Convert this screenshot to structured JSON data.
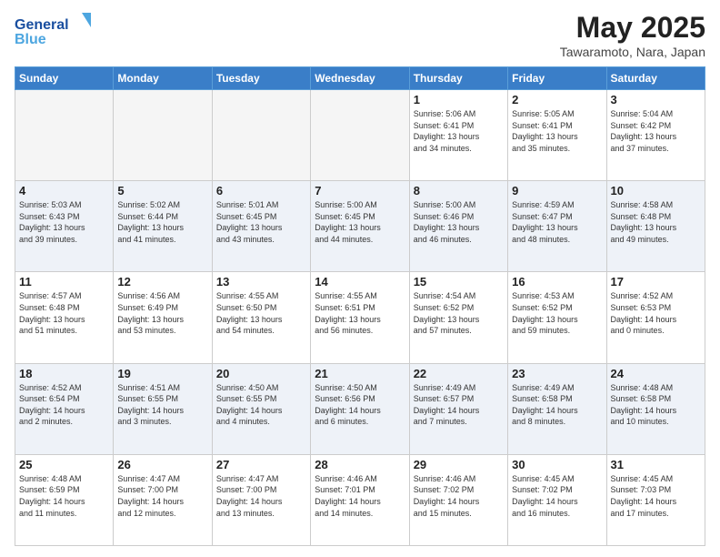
{
  "header": {
    "logo_general": "General",
    "logo_blue": "Blue",
    "title": "May 2025",
    "location": "Tawaramoto, Nara, Japan"
  },
  "weekdays": [
    "Sunday",
    "Monday",
    "Tuesday",
    "Wednesday",
    "Thursday",
    "Friday",
    "Saturday"
  ],
  "rows": [
    [
      {
        "day": "",
        "info": ""
      },
      {
        "day": "",
        "info": ""
      },
      {
        "day": "",
        "info": ""
      },
      {
        "day": "",
        "info": ""
      },
      {
        "day": "1",
        "info": "Sunrise: 5:06 AM\nSunset: 6:41 PM\nDaylight: 13 hours\nand 34 minutes."
      },
      {
        "day": "2",
        "info": "Sunrise: 5:05 AM\nSunset: 6:41 PM\nDaylight: 13 hours\nand 35 minutes."
      },
      {
        "day": "3",
        "info": "Sunrise: 5:04 AM\nSunset: 6:42 PM\nDaylight: 13 hours\nand 37 minutes."
      }
    ],
    [
      {
        "day": "4",
        "info": "Sunrise: 5:03 AM\nSunset: 6:43 PM\nDaylight: 13 hours\nand 39 minutes."
      },
      {
        "day": "5",
        "info": "Sunrise: 5:02 AM\nSunset: 6:44 PM\nDaylight: 13 hours\nand 41 minutes."
      },
      {
        "day": "6",
        "info": "Sunrise: 5:01 AM\nSunset: 6:45 PM\nDaylight: 13 hours\nand 43 minutes."
      },
      {
        "day": "7",
        "info": "Sunrise: 5:00 AM\nSunset: 6:45 PM\nDaylight: 13 hours\nand 44 minutes."
      },
      {
        "day": "8",
        "info": "Sunrise: 5:00 AM\nSunset: 6:46 PM\nDaylight: 13 hours\nand 46 minutes."
      },
      {
        "day": "9",
        "info": "Sunrise: 4:59 AM\nSunset: 6:47 PM\nDaylight: 13 hours\nand 48 minutes."
      },
      {
        "day": "10",
        "info": "Sunrise: 4:58 AM\nSunset: 6:48 PM\nDaylight: 13 hours\nand 49 minutes."
      }
    ],
    [
      {
        "day": "11",
        "info": "Sunrise: 4:57 AM\nSunset: 6:48 PM\nDaylight: 13 hours\nand 51 minutes."
      },
      {
        "day": "12",
        "info": "Sunrise: 4:56 AM\nSunset: 6:49 PM\nDaylight: 13 hours\nand 53 minutes."
      },
      {
        "day": "13",
        "info": "Sunrise: 4:55 AM\nSunset: 6:50 PM\nDaylight: 13 hours\nand 54 minutes."
      },
      {
        "day": "14",
        "info": "Sunrise: 4:55 AM\nSunset: 6:51 PM\nDaylight: 13 hours\nand 56 minutes."
      },
      {
        "day": "15",
        "info": "Sunrise: 4:54 AM\nSunset: 6:52 PM\nDaylight: 13 hours\nand 57 minutes."
      },
      {
        "day": "16",
        "info": "Sunrise: 4:53 AM\nSunset: 6:52 PM\nDaylight: 13 hours\nand 59 minutes."
      },
      {
        "day": "17",
        "info": "Sunrise: 4:52 AM\nSunset: 6:53 PM\nDaylight: 14 hours\nand 0 minutes."
      }
    ],
    [
      {
        "day": "18",
        "info": "Sunrise: 4:52 AM\nSunset: 6:54 PM\nDaylight: 14 hours\nand 2 minutes."
      },
      {
        "day": "19",
        "info": "Sunrise: 4:51 AM\nSunset: 6:55 PM\nDaylight: 14 hours\nand 3 minutes."
      },
      {
        "day": "20",
        "info": "Sunrise: 4:50 AM\nSunset: 6:55 PM\nDaylight: 14 hours\nand 4 minutes."
      },
      {
        "day": "21",
        "info": "Sunrise: 4:50 AM\nSunset: 6:56 PM\nDaylight: 14 hours\nand 6 minutes."
      },
      {
        "day": "22",
        "info": "Sunrise: 4:49 AM\nSunset: 6:57 PM\nDaylight: 14 hours\nand 7 minutes."
      },
      {
        "day": "23",
        "info": "Sunrise: 4:49 AM\nSunset: 6:58 PM\nDaylight: 14 hours\nand 8 minutes."
      },
      {
        "day": "24",
        "info": "Sunrise: 4:48 AM\nSunset: 6:58 PM\nDaylight: 14 hours\nand 10 minutes."
      }
    ],
    [
      {
        "day": "25",
        "info": "Sunrise: 4:48 AM\nSunset: 6:59 PM\nDaylight: 14 hours\nand 11 minutes."
      },
      {
        "day": "26",
        "info": "Sunrise: 4:47 AM\nSunset: 7:00 PM\nDaylight: 14 hours\nand 12 minutes."
      },
      {
        "day": "27",
        "info": "Sunrise: 4:47 AM\nSunset: 7:00 PM\nDaylight: 14 hours\nand 13 minutes."
      },
      {
        "day": "28",
        "info": "Sunrise: 4:46 AM\nSunset: 7:01 PM\nDaylight: 14 hours\nand 14 minutes."
      },
      {
        "day": "29",
        "info": "Sunrise: 4:46 AM\nSunset: 7:02 PM\nDaylight: 14 hours\nand 15 minutes."
      },
      {
        "day": "30",
        "info": "Sunrise: 4:45 AM\nSunset: 7:02 PM\nDaylight: 14 hours\nand 16 minutes."
      },
      {
        "day": "31",
        "info": "Sunrise: 4:45 AM\nSunset: 7:03 PM\nDaylight: 14 hours\nand 17 minutes."
      }
    ]
  ]
}
